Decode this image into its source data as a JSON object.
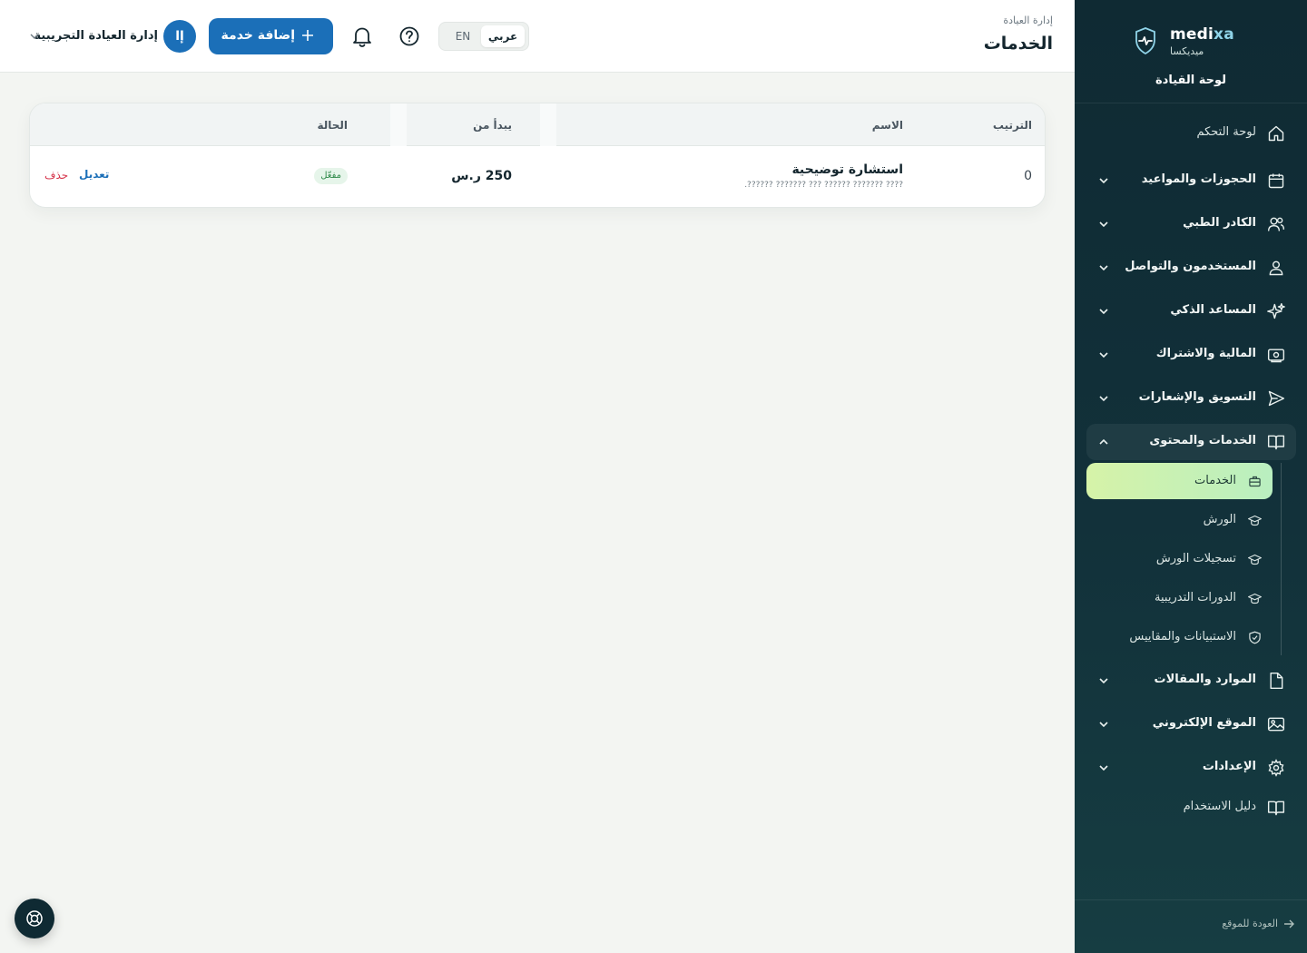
{
  "brand": {
    "name_prefix": "medi",
    "name_accent": "xa",
    "sub": "ميديكسا",
    "title": "لوحة القيادة"
  },
  "header": {
    "breadcrumb": "إدارة العيادة",
    "title": "الخدمات",
    "lang_ar": "عربي",
    "lang_en": "EN",
    "add_button": "إضافة خدمة",
    "account_initial": "إا",
    "account_name": "إدارة العيادة التجريبية"
  },
  "sidebar": {
    "items": [
      {
        "label": "لوحة التحكم",
        "icon": "home-icon"
      },
      {
        "label": "الحجوزات والمواعيد",
        "icon": "calendar-icon"
      },
      {
        "label": "الكادر الطبي",
        "icon": "users-icon"
      },
      {
        "label": "المستخدمون والتواصل",
        "icon": "user-icon"
      },
      {
        "label": "المساعد الذكي",
        "icon": "sparkles-icon"
      },
      {
        "label": "المالية والاشتراك",
        "icon": "banknote-icon"
      },
      {
        "label": "التسويق والإشعارات",
        "icon": "send-icon"
      },
      {
        "label": "الخدمات والمحتوى",
        "icon": "book-icon"
      },
      {
        "label": "الموارد والمقالات",
        "icon": "file-icon"
      },
      {
        "label": "الموقع الإلكتروني",
        "icon": "image-icon"
      },
      {
        "label": "الإعدادات",
        "icon": "gear-icon"
      },
      {
        "label": "دليل الاستخدام",
        "icon": "book-open-icon"
      }
    ],
    "sub_items": [
      {
        "label": "الخدمات",
        "icon": "briefcase-icon"
      },
      {
        "label": "الورش",
        "icon": "graduation-cap-icon"
      },
      {
        "label": "تسجيلات الورش",
        "icon": "graduation-cap-icon"
      },
      {
        "label": "الدورات التدريبية",
        "icon": "graduation-cap-icon"
      },
      {
        "label": "الاستبيانات والمقاييس",
        "icon": "shield-check-icon"
      }
    ],
    "back_link": "العودة للموقع"
  },
  "table": {
    "columns": [
      "الترتيب",
      "الاسم",
      "يبدأ من",
      "الحالة"
    ],
    "rows": [
      {
        "order": "0",
        "name": "استشارة توضيحية",
        "description": "???? ??????? ?????? ??? ??????? ??????.",
        "price": "250 ر.س",
        "status": "مفعّل",
        "edit": "تعديل",
        "delete": "حذف"
      }
    ]
  },
  "colors": {
    "primary": "#1b6fb8",
    "sidebar_bg": "#0f2a33",
    "active_sub": "#d6f3a8",
    "danger": "#d6334a",
    "success": "#2f8a4a"
  }
}
